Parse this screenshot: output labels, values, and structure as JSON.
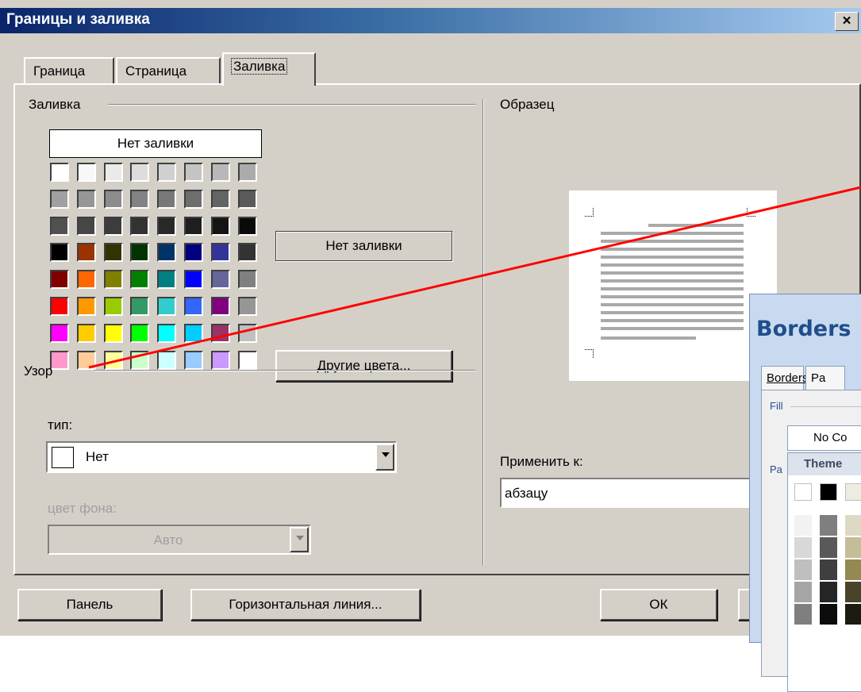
{
  "dialog": {
    "title": "Границы и заливка",
    "close_glyph": "×",
    "tabs": [
      {
        "label": "Граница",
        "active": false
      },
      {
        "label": "Страница",
        "active": false
      },
      {
        "label": "Заливка",
        "active": true
      }
    ]
  },
  "fill": {
    "group_label": "Заливка",
    "no_fill_label": "Нет заливки",
    "selected_label": "Нет заливки",
    "more_colors_label": "Другие цвета...",
    "palette": [
      [
        "#ffffff",
        "#f8f8f8",
        "#eaeaea",
        "#dddddd",
        "#d0d0d0",
        "#c4c4c4",
        "#b8b8b8",
        "#ababab"
      ],
      [
        "#a0a0a0",
        "#969696",
        "#8c8c8c",
        "#828282",
        "#787878",
        "#6e6e6e",
        "#646464",
        "#5a5a5a"
      ],
      [
        "#505050",
        "#464646",
        "#3c3c3c",
        "#323232",
        "#282828",
        "#1e1e1e",
        "#141414",
        "#0a0a0a"
      ],
      [
        "#000000",
        "#993300",
        "#333300",
        "#003300",
        "#003366",
        "#000080",
        "#333399",
        "#333333"
      ],
      [
        "#800000",
        "#ff6600",
        "#808000",
        "#008000",
        "#008080",
        "#0000ff",
        "#666699",
        "#808080"
      ],
      [
        "#ff0000",
        "#ff9900",
        "#99cc00",
        "#339966",
        "#33cccc",
        "#3366ff",
        "#800080",
        "#969696"
      ],
      [
        "#ff00ff",
        "#ffcc00",
        "#ffff00",
        "#00ff00",
        "#00ffff",
        "#00ccff",
        "#993366",
        "#c0c0c0"
      ],
      [
        "#ff99cc",
        "#ffcc99",
        "#ffff99",
        "#ccffcc",
        "#ccffff",
        "#99ccff",
        "#cc99ff",
        "#ffffff"
      ]
    ]
  },
  "pattern": {
    "group_label": "Узор",
    "type_label": "тип:",
    "type_value": "Нет",
    "bg_label": "цвет фона:",
    "bg_value": "Авто"
  },
  "sample": {
    "group_label": "Образец",
    "apply_label": "Применить к:",
    "apply_value": "абзацу"
  },
  "buttons": {
    "panel": "Панель",
    "horizontal_line": "Горизонтальная линия...",
    "ok": "ОК"
  },
  "overlay": {
    "title": "Borders",
    "tab_borders": "Borders",
    "tab_partial": "Pa",
    "fill_label": "Fill",
    "no_color_partial": "No Co",
    "theme_partial": "Theme",
    "pattern_partial": "Pa"
  },
  "colors": {
    "annotation_line": "#ff0000",
    "dialog_bg": "#d4d0c8",
    "title_gradient_start": "#0a246a"
  }
}
